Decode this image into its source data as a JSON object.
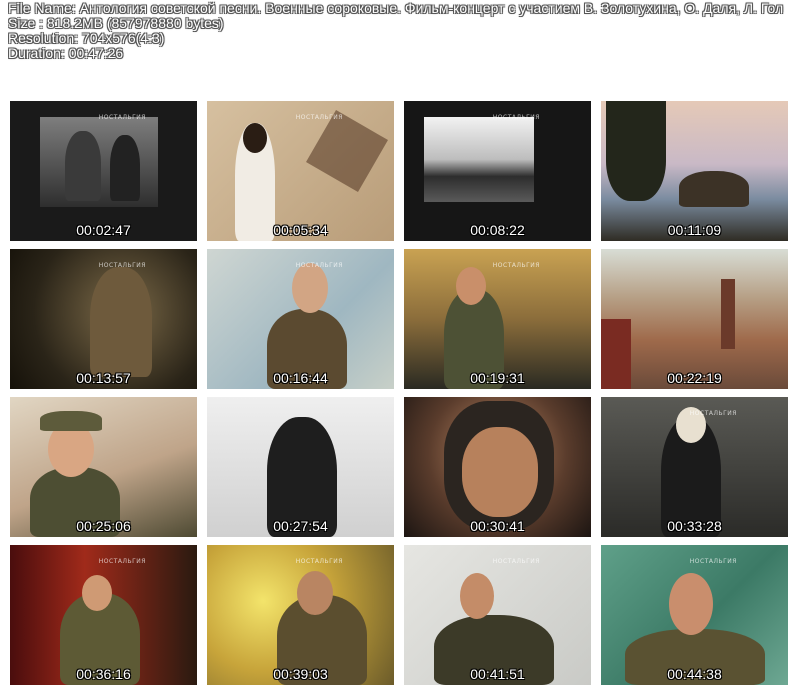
{
  "info": {
    "file_name": "File Name: Антология советской песни. Военные сороковые. Фильм-концерт с участием В. Золотухина, О. Даля, Л. Гол",
    "size": "Size : 818.2MB (857978880 bytes)",
    "resolution": "Resolution: 704x576(4:3)",
    "duration": "Duration: 00:47:26"
  },
  "thumbnails": [
    {
      "timestamp": "00:02:47",
      "watermark": "НОСТАЛЬГИЯ"
    },
    {
      "timestamp": "00:05:34",
      "watermark": "НОСТАЛЬГИЯ"
    },
    {
      "timestamp": "00:08:22",
      "watermark": "НОСТАЛЬГИЯ"
    },
    {
      "timestamp": "00:11:09",
      "watermark": ""
    },
    {
      "timestamp": "00:13:57",
      "watermark": "НОСТАЛЬГИЯ"
    },
    {
      "timestamp": "00:16:44",
      "watermark": "НОСТАЛЬГИЯ"
    },
    {
      "timestamp": "00:19:31",
      "watermark": "НОСТАЛЬГИЯ"
    },
    {
      "timestamp": "00:22:19",
      "watermark": ""
    },
    {
      "timestamp": "00:25:06",
      "watermark": ""
    },
    {
      "timestamp": "00:27:54",
      "watermark": ""
    },
    {
      "timestamp": "00:30:41",
      "watermark": ""
    },
    {
      "timestamp": "00:33:28",
      "watermark": "НОСТАЛЬГИЯ"
    },
    {
      "timestamp": "00:36:16",
      "watermark": "НОСТАЛЬГИЯ"
    },
    {
      "timestamp": "00:39:03",
      "watermark": "НОСТАЛЬГИЯ"
    },
    {
      "timestamp": "00:41:51",
      "watermark": "НОСТАЛЬГИЯ"
    },
    {
      "timestamp": "00:44:38",
      "watermark": "НОСТАЛЬГИЯ"
    }
  ]
}
